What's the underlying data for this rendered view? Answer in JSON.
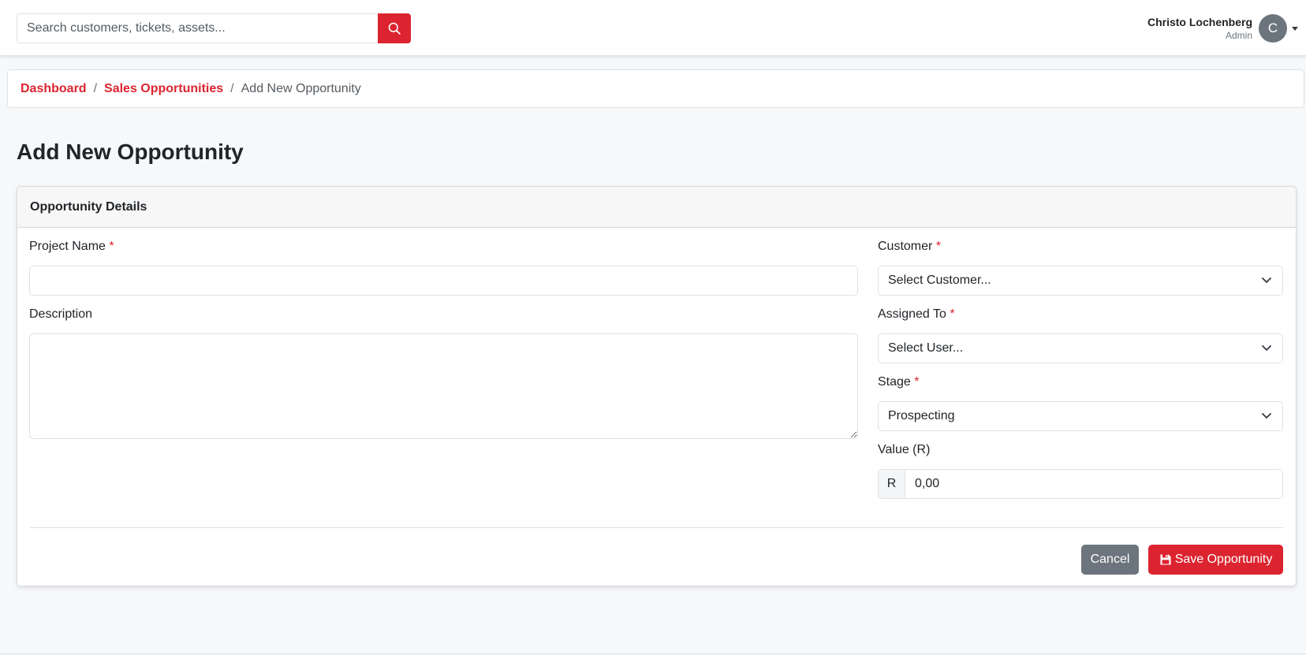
{
  "colors": {
    "accent": "#dc2430",
    "secondary": "#6c757d",
    "page_bg": "#f7f8fa"
  },
  "search": {
    "placeholder": "Search customers, tickets, assets...",
    "button_icon": "search-icon"
  },
  "user": {
    "name": "Christo Lochenberg",
    "role": "Admin",
    "avatar_initial": "C"
  },
  "breadcrumb": {
    "items": [
      "Dashboard",
      "Sales Opportunities"
    ],
    "separator": "/",
    "current": "Add New Opportunity"
  },
  "page": {
    "title": "Add New Opportunity"
  },
  "card": {
    "header": "Opportunity Details"
  },
  "form": {
    "project_name": {
      "label": "Project Name",
      "required_mark": "*",
      "value": ""
    },
    "description": {
      "label": "Description",
      "value": ""
    },
    "customer": {
      "label": "Customer",
      "required_mark": "*",
      "selected": "Select Customer..."
    },
    "assigned_to": {
      "label": "Assigned To",
      "required_mark": "*",
      "selected": "Select User..."
    },
    "stage": {
      "label": "Stage",
      "required_mark": "*",
      "selected": "Prospecting"
    },
    "value": {
      "label": "Value (R)",
      "prefix": "R",
      "value": "0,00"
    }
  },
  "actions": {
    "cancel_label": "Cancel",
    "save_label": "Save Opportunity",
    "save_icon": "save-icon"
  }
}
